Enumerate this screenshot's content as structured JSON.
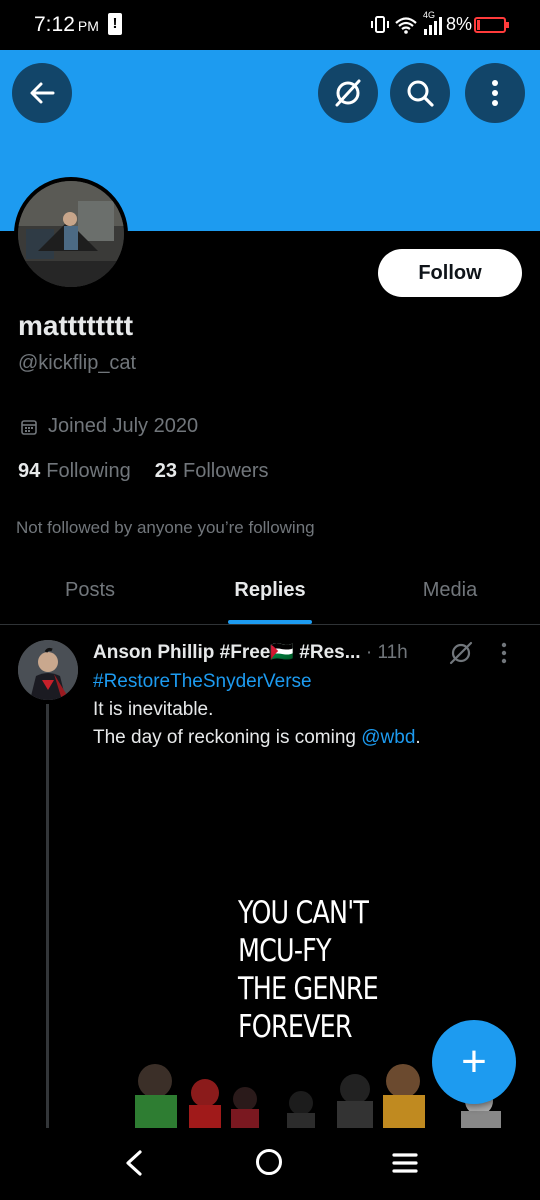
{
  "status_bar": {
    "time": "7:12",
    "ampm": "PM",
    "network_type": "4G",
    "battery_percent": "8%",
    "battery_color": "#ff3b3b"
  },
  "header": {
    "back_icon": "arrow-left-icon",
    "grok_icon": "grok-icon",
    "search_icon": "search-icon",
    "more_icon": "more-vertical-icon",
    "banner_color": "#1d9bf0"
  },
  "profile": {
    "display_name": "matttttttt",
    "handle": "@kickflip_cat",
    "joined": "Joined July 2020",
    "following_count": "94",
    "following_label": "Following",
    "followers_count": "23",
    "followers_label": "Followers",
    "not_followed_text": "Not followed by anyone you’re following",
    "follow_button": "Follow"
  },
  "tabs": [
    {
      "label": "Posts",
      "active": false
    },
    {
      "label": "Replies",
      "active": true
    },
    {
      "label": "Media",
      "active": false
    }
  ],
  "post": {
    "author": "Anson Phillip #Free🇵🇸 #Res...",
    "separator": "·",
    "time": "11h",
    "hashtag": "#RestoreTheSnyderVerse",
    "line1": "It is inevitable.",
    "line2_prefix": "The day of reckoning is coming ",
    "mention": "@wbd",
    "line2_suffix": ".",
    "media_text": [
      "YOU CAN'T",
      "MCU-FY",
      "THE GENRE",
      "FOREVER"
    ]
  },
  "fab": {
    "label": "+"
  },
  "accent_color": "#1d9bf0"
}
